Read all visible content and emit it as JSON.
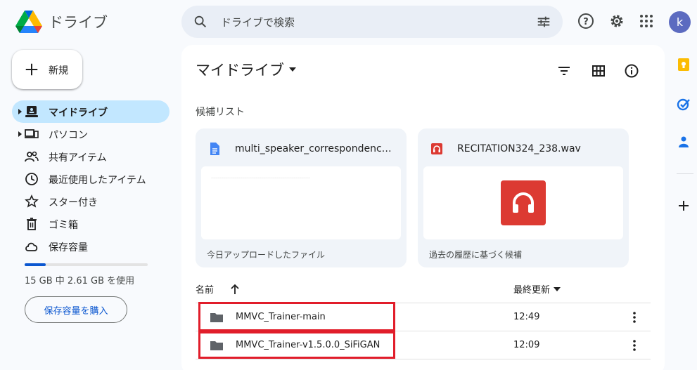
{
  "header": {
    "app_title": "ドライブ",
    "search_placeholder": "ドライブで検索",
    "avatar_letter": "k"
  },
  "sidebar": {
    "new_label": "新規",
    "items": [
      {
        "label": "マイドライブ",
        "icon": "my-drive-icon",
        "active": true
      },
      {
        "label": "パソコン",
        "icon": "computer-icon"
      },
      {
        "label": "共有アイテム",
        "icon": "shared-icon"
      },
      {
        "label": "最近使用したアイテム",
        "icon": "clock-icon"
      },
      {
        "label": "スター付き",
        "icon": "star-icon"
      },
      {
        "label": "ゴミ箱",
        "icon": "trash-icon"
      },
      {
        "label": "保存容量",
        "icon": "cloud-icon"
      }
    ],
    "storage_text": "15 GB 中 2.61 GB を使用",
    "storage_fraction": 0.174,
    "buy_label": "保存容量を購入"
  },
  "main": {
    "title": "マイドライブ",
    "suggestions_label": "候補リスト",
    "cards": [
      {
        "name": "multi_speaker_correspondence.t...",
        "footer": "今日アップロードしたファイル",
        "icon": "doc-icon"
      },
      {
        "name": "RECITATION324_238.wav",
        "footer": "過去の履歴に基づく候補",
        "icon": "audio-icon"
      }
    ],
    "columns": {
      "name": "名前",
      "modified": "最終更新"
    },
    "files": [
      {
        "name": "MMVC_Trainer-main",
        "time": "12:49"
      },
      {
        "name": "MMVC_Trainer-v1.5.0.0_SiFiGAN",
        "time": "12:09"
      }
    ]
  },
  "colors": {
    "accent": "#0b57d0",
    "active_nav": "#c2e7ff",
    "highlight": "#e11d2a",
    "audio": "#dc3a32"
  }
}
